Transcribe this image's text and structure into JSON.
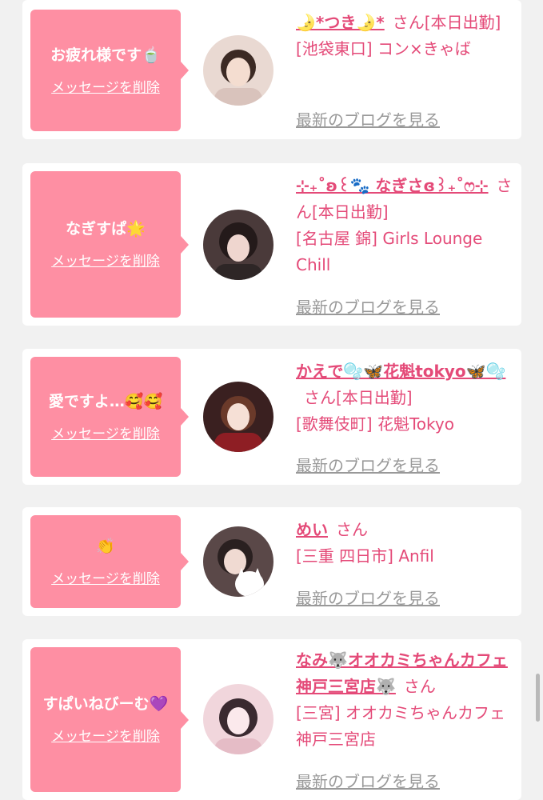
{
  "delete_label": "メッセージを削除",
  "blog_label": "最新のブログを見る",
  "san": "さん",
  "status": "[本日出勤]",
  "colors": {
    "bubble": "#fe8fa3",
    "name": "#e44a78",
    "link_gray": "#999999"
  },
  "cards": [
    {
      "message": "お疲れ様です🍵",
      "name": "🌛*つき🌛*",
      "status": "[本日出勤]",
      "shop": "[池袋東口] コン×きゃば"
    },
    {
      "message": "なぎすぱ🌟",
      "name": "⊹₊˚ʚ︎꒰🐾 なぎさɞ꒱₊˚ෆ⊹",
      "status": "[本日出勤]",
      "shop": "[名古屋 錦] Girls Lounge Chill"
    },
    {
      "message": "愛ですよ…🥰🥰",
      "name": "かえで🫧🦋花魁tokyo🦋🫧",
      "status": "[本日出勤]",
      "shop": "[歌舞伎町] 花魁Tokyo"
    },
    {
      "message": "👏",
      "name": "めい",
      "status": "",
      "shop": "[三重 四日市] Anfil"
    },
    {
      "message": "すぱいねびーむ💜",
      "name": "なみ🐺オオカミちゃんカフェ神戸三宮店🐺",
      "status": "",
      "shop": "[三宮] オオカミちゃんカフェ神戸三宮店"
    }
  ]
}
